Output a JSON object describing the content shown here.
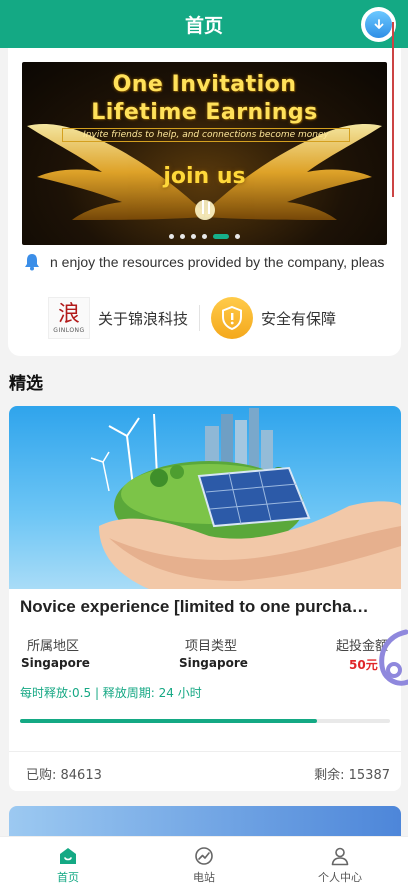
{
  "header": {
    "title": "首页"
  },
  "banner": {
    "line1": "One Invitation",
    "line2": "Lifetime Earnings",
    "subtitle": "Invite friends to help, and connections become money",
    "cta": "join us",
    "slide_count": 6,
    "active_index": 4
  },
  "notice": {
    "text": "n enjoy the resources provided by the company, pleas"
  },
  "info": {
    "about_label": "关于锦浪科技",
    "logo_text": "GINLONG",
    "security_label": "安全有保障"
  },
  "section": {
    "title": "精选"
  },
  "product": {
    "name": "Novice experience [limited to one purcha…",
    "region_label": "所属地区",
    "region_value": "Singapore",
    "type_label": "项目类型",
    "type_value": "Singapore",
    "min_label": "起投金额",
    "min_value": "50元",
    "release": "每时释放:0.5 | 释放周期: 24 小时",
    "progress_fraction": 0.803,
    "bought": "已购: 84613",
    "remaining": "剩余: 15387"
  },
  "colors": {
    "primary": "#14a984",
    "price": "#e0262a"
  },
  "tabs": [
    {
      "label": "首页",
      "icon": "home-icon",
      "active": true
    },
    {
      "label": "电站",
      "icon": "chart-icon",
      "active": false
    },
    {
      "label": "个人中心",
      "icon": "user-icon",
      "active": false
    }
  ]
}
